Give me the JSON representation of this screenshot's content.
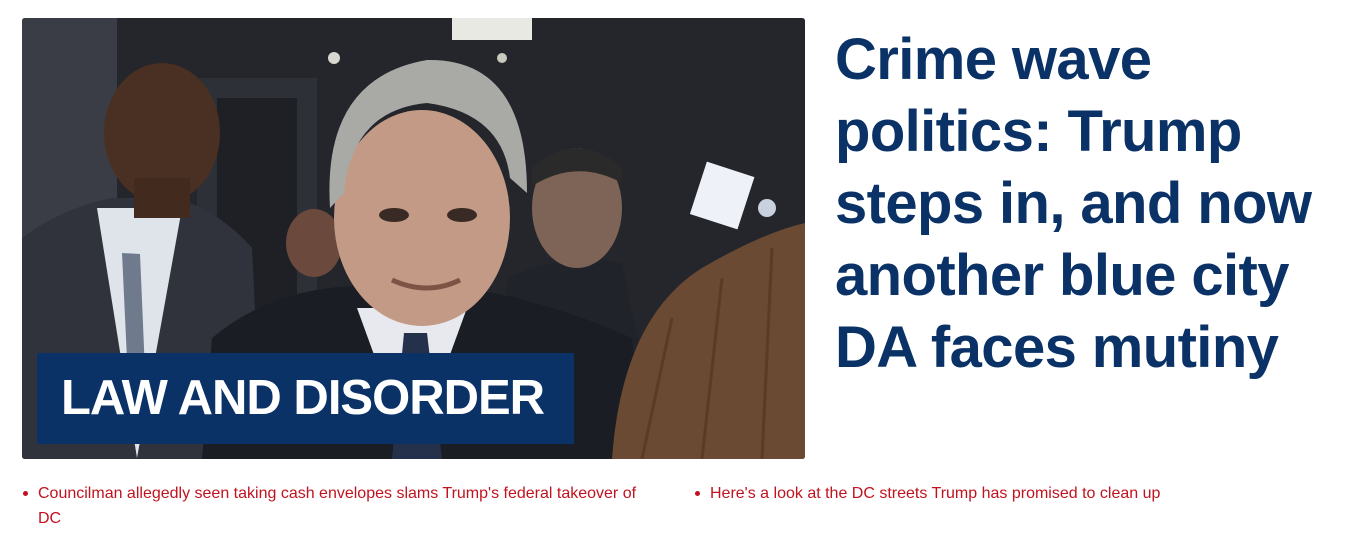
{
  "feature": {
    "image": {
      "icon": "photo-group-of-men-in-hallway",
      "kicker": "LAW AND DISORDER"
    },
    "headline": "Crime wave politics: Trump steps in, and now another blue city DA faces mutiny"
  },
  "related_links": [
    {
      "text": "Councilman allegedly seen taking cash envelopes slams Trump's federal takeover of DC"
    },
    {
      "text": "Here's a look at the DC streets Trump has promised to clean up"
    }
  ],
  "colors": {
    "brand_navy": "#0a3267",
    "link_red": "#c1121f"
  }
}
